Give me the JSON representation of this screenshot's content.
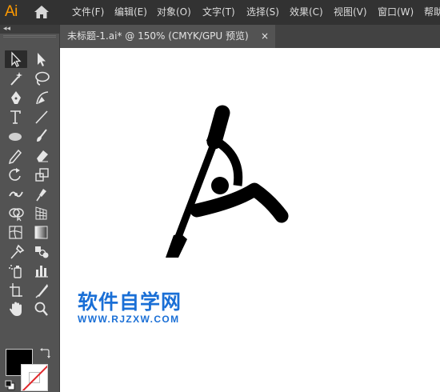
{
  "app": {
    "logo_text": "Ai"
  },
  "menu": [
    "文件(F)",
    "编辑(E)",
    "对象(O)",
    "文字(T)",
    "选择(S)",
    "效果(C)",
    "视图(V)",
    "窗口(W)",
    "帮助"
  ],
  "document_tab": {
    "title": "未标题-1.ai* @ 150% (CMYK/GPU 预览)",
    "close": "×"
  },
  "tools_panel": {
    "collapse": "◂◂"
  },
  "watermark": {
    "title": "软件自学网",
    "url": "WWW.RJZXW.COM"
  },
  "colors": {
    "menubar": "#323232",
    "panel": "#535353",
    "canvas": "#ffffff",
    "fill": "#000000",
    "stroke": "#ffffff",
    "watermark": "#1a6fd6"
  }
}
